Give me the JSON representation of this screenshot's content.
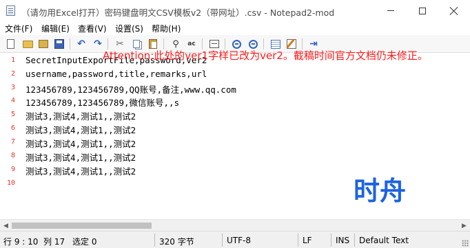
{
  "window": {
    "title": "（请勿用Excel打开）密码键盘明文CSV模板v2（带网址）.csv - Notepad2-mod"
  },
  "menu": [
    {
      "label": "文件(F)"
    },
    {
      "label": "编辑(E)"
    },
    {
      "label": "查看(V)"
    },
    {
      "label": "设置(S)"
    },
    {
      "label": "帮助(H)"
    }
  ],
  "toolbar": {
    "icons": [
      "new-file-icon",
      "open-folder-icon",
      "browse-icon",
      "save-icon",
      "undo-icon",
      "redo-icon",
      "cut-icon",
      "copy-icon",
      "paste-icon",
      "find-icon",
      "replace-icon",
      "word-wrap-icon",
      "zoom-in-icon",
      "zoom-out-icon",
      "color-scheme-icon",
      "customize-icon",
      "exit-icon"
    ]
  },
  "annotation": {
    "text": "Attention:此处的ver1字样已改为ver2。截稿时间官方文档仍未修正。",
    "color": "#ff1a1a"
  },
  "editor": {
    "lines": [
      {
        "num": "1",
        "text": "SecretInputExportFile,password,ver2"
      },
      {
        "num": "2",
        "text": "username,password,title,remarks,url"
      },
      {
        "num": "3",
        "text": "123456789,123456789,QQ账号,备注,www.qq.com"
      },
      {
        "num": "4",
        "text": "123456789,123456789,微信账号,,s"
      },
      {
        "num": "5",
        "text": "测试3,测试4,测试1,,测试2"
      },
      {
        "num": "6",
        "text": "测试3,测试4,测试1,,测试2"
      },
      {
        "num": "7",
        "text": "测试3,测试4,测试1,,测试2"
      },
      {
        "num": "8",
        "text": "测试3,测试4,测试1,,测试2"
      },
      {
        "num": "9",
        "text": "测试3,测试4,测试1,,测试2"
      },
      {
        "num": "10",
        "text": ""
      }
    ],
    "line_number_color": "#e8302a"
  },
  "watermark": {
    "text": "时舟",
    "color": "#1d63e0"
  },
  "statusbar": {
    "position": "行 9 : 10",
    "column": "列 17",
    "selection": "选定 0",
    "size": "320 字节",
    "encoding": "UTF-8",
    "line_ending": "LF",
    "insert_mode": "INS",
    "scheme": "Default Text"
  }
}
